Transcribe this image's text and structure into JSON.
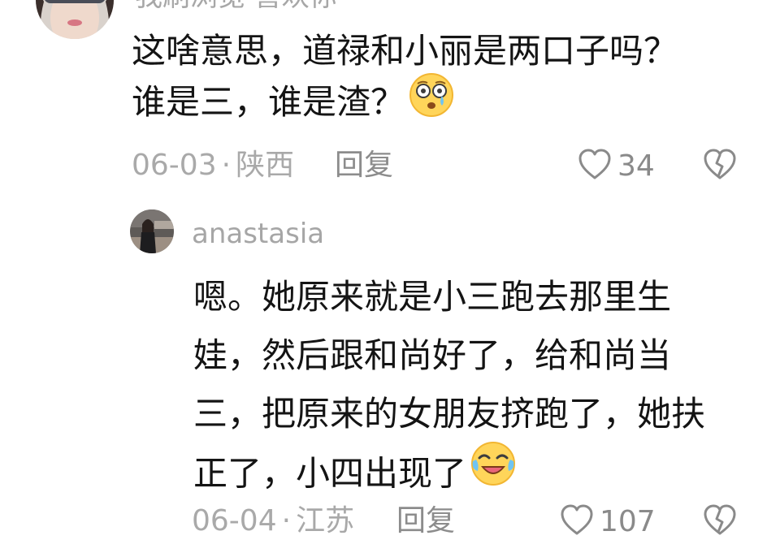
{
  "comment1": {
    "username": "我刷浏览 喜欢你",
    "text_lines": [
      "这啥意思，道禄和小丽是两口子吗？",
      "谁是三，谁是渣？"
    ],
    "emoji": "flushed-crying-face-emoji",
    "date": "06-03",
    "separator": "·",
    "location": "陕西",
    "reply_label": "回复",
    "like_count": "34"
  },
  "reply1": {
    "username": "anastasia",
    "text_lines": [
      "嗯。她原来就是小三跑去那里生",
      "娃，然后跟和尚好了，给和尚当",
      "三，把原来的女朋友挤跑了，她扶",
      "正了，小四出现了"
    ],
    "emoji": "laughing-crying-face-emoji",
    "date": "06-04",
    "separator": "·",
    "location": "江苏",
    "reply_label": "回复",
    "like_count": "107"
  },
  "colors": {
    "meta_text": "#a9a9a9",
    "body_text": "#141414",
    "icon_stroke": "#8a8a8a"
  }
}
